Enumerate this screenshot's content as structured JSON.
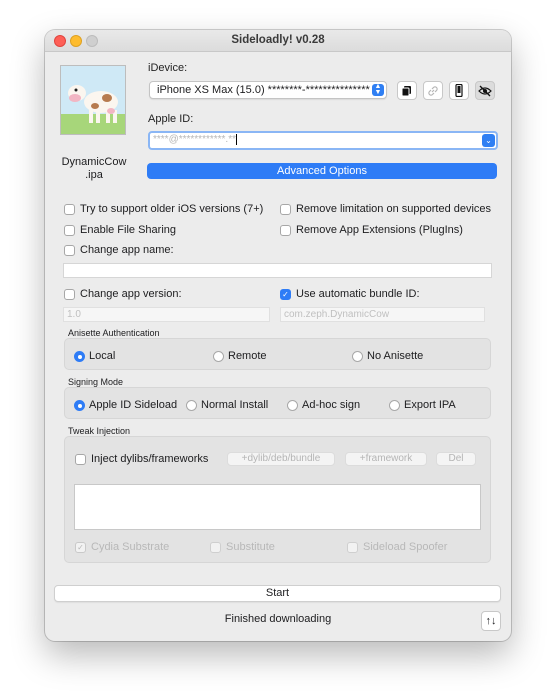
{
  "window": {
    "title": "Sideloadly! v0.28"
  },
  "app": {
    "ipa_name": "DynamicCow .ipa",
    "icon": "cow-app-icon"
  },
  "idevice": {
    "label": "iDevice:",
    "selected": "iPhone XS Max (15.0) ********-***************",
    "buttons": [
      {
        "name": "copy-icon",
        "glyph": "⧉"
      },
      {
        "name": "link-icon",
        "glyph": "🔗"
      },
      {
        "name": "phone-icon",
        "glyph": "▯"
      },
      {
        "name": "eye-slash-icon",
        "glyph": "◉"
      }
    ]
  },
  "apple_id": {
    "label": "Apple ID:",
    "value": "****@************.**"
  },
  "advanced_button": "Advanced Options",
  "options": {
    "older_ios": "Try to support older iOS versions (7+)",
    "remove_limitation": "Remove limitation on supported devices",
    "file_sharing": "Enable File Sharing",
    "remove_extensions": "Remove App Extensions (PlugIns)",
    "change_name": "Change app name:",
    "change_version": "Change app version:",
    "version_placeholder": "1.0",
    "auto_bundle": "Use automatic bundle ID:",
    "bundle_placeholder": "com.zeph.DynamicCow"
  },
  "anisette": {
    "label": "Anisette Authentication",
    "options": [
      "Local",
      "Remote",
      "No Anisette"
    ],
    "selected": "Local"
  },
  "signing": {
    "label": "Signing Mode",
    "options": [
      "Apple ID Sideload",
      "Normal Install",
      "Ad-hoc sign",
      "Export IPA"
    ],
    "selected": "Apple ID Sideload"
  },
  "tweak": {
    "label": "Tweak Injection",
    "inject_label": "Inject dylibs/frameworks",
    "btn_dylib": "+dylib/deb/bundle",
    "btn_framework": "+framework",
    "btn_del": "Del",
    "cydia": "Cydia Substrate",
    "substitute": "Substitute",
    "spoofer": "Sideload Spoofer"
  },
  "start_button": "Start",
  "status": "Finished downloading",
  "log_button": "↑↓",
  "colors": {
    "accent": "#2e7cf6",
    "window_bg": "#ececec"
  }
}
